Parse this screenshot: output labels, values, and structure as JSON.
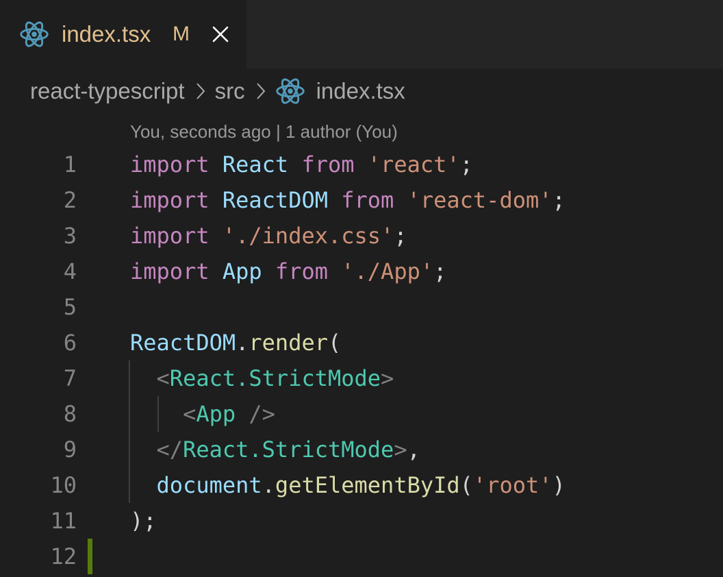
{
  "tab": {
    "title": "index.tsx",
    "badge": "M",
    "icon": "react-icon",
    "close_icon": "close-icon"
  },
  "breadcrumb": {
    "items": [
      "react-typescript",
      "src",
      "index.tsx"
    ]
  },
  "codelens": {
    "text": "You, seconds ago | 1 author (You)"
  },
  "editor": {
    "line_numbers": [
      "1",
      "2",
      "3",
      "4",
      "5",
      "6",
      "7",
      "8",
      "9",
      "10",
      "11",
      "12"
    ],
    "lines": [
      [
        {
          "t": "import",
          "c": "kw"
        },
        {
          "t": " ",
          "c": "plain"
        },
        {
          "t": "React",
          "c": "var"
        },
        {
          "t": " ",
          "c": "plain"
        },
        {
          "t": "from",
          "c": "kw"
        },
        {
          "t": " ",
          "c": "plain"
        },
        {
          "t": "'react'",
          "c": "str"
        },
        {
          "t": ";",
          "c": "plain"
        }
      ],
      [
        {
          "t": "import",
          "c": "kw"
        },
        {
          "t": " ",
          "c": "plain"
        },
        {
          "t": "ReactDOM",
          "c": "var"
        },
        {
          "t": " ",
          "c": "plain"
        },
        {
          "t": "from",
          "c": "kw"
        },
        {
          "t": " ",
          "c": "plain"
        },
        {
          "t": "'react-dom'",
          "c": "str"
        },
        {
          "t": ";",
          "c": "plain"
        }
      ],
      [
        {
          "t": "import",
          "c": "kw"
        },
        {
          "t": " ",
          "c": "plain"
        },
        {
          "t": "'./index.css'",
          "c": "str"
        },
        {
          "t": ";",
          "c": "plain"
        }
      ],
      [
        {
          "t": "import",
          "c": "kw"
        },
        {
          "t": " ",
          "c": "plain"
        },
        {
          "t": "App",
          "c": "var"
        },
        {
          "t": " ",
          "c": "plain"
        },
        {
          "t": "from",
          "c": "kw"
        },
        {
          "t": " ",
          "c": "plain"
        },
        {
          "t": "'./App'",
          "c": "str"
        },
        {
          "t": ";",
          "c": "plain"
        }
      ],
      [],
      [
        {
          "t": "ReactDOM",
          "c": "var"
        },
        {
          "t": ".",
          "c": "plain"
        },
        {
          "t": "render",
          "c": "fn"
        },
        {
          "t": "(",
          "c": "plain"
        }
      ],
      [
        {
          "t": "  ",
          "c": "plain"
        },
        {
          "t": "<",
          "c": "punct"
        },
        {
          "t": "React.StrictMode",
          "c": "tag"
        },
        {
          "t": ">",
          "c": "punct"
        }
      ],
      [
        {
          "t": "    ",
          "c": "plain"
        },
        {
          "t": "<",
          "c": "punct"
        },
        {
          "t": "App",
          "c": "tag"
        },
        {
          "t": " />",
          "c": "punct"
        }
      ],
      [
        {
          "t": "  ",
          "c": "plain"
        },
        {
          "t": "</",
          "c": "punct"
        },
        {
          "t": "React.StrictMode",
          "c": "tag"
        },
        {
          "t": ">",
          "c": "punct"
        },
        {
          "t": ",",
          "c": "plain"
        }
      ],
      [
        {
          "t": "  ",
          "c": "plain"
        },
        {
          "t": "document",
          "c": "var"
        },
        {
          "t": ".",
          "c": "plain"
        },
        {
          "t": "getElementById",
          "c": "fn"
        },
        {
          "t": "(",
          "c": "plain"
        },
        {
          "t": "'root'",
          "c": "str"
        },
        {
          "t": ")",
          "c": "plain"
        }
      ],
      [
        {
          "t": ");",
          "c": "plain"
        }
      ],
      []
    ]
  },
  "colors": {
    "background": "#1e1e1e",
    "tabbar": "#252526",
    "modified": "#e2c08d",
    "react_icon": "#519aba",
    "added_gutter": "#587c0c"
  }
}
